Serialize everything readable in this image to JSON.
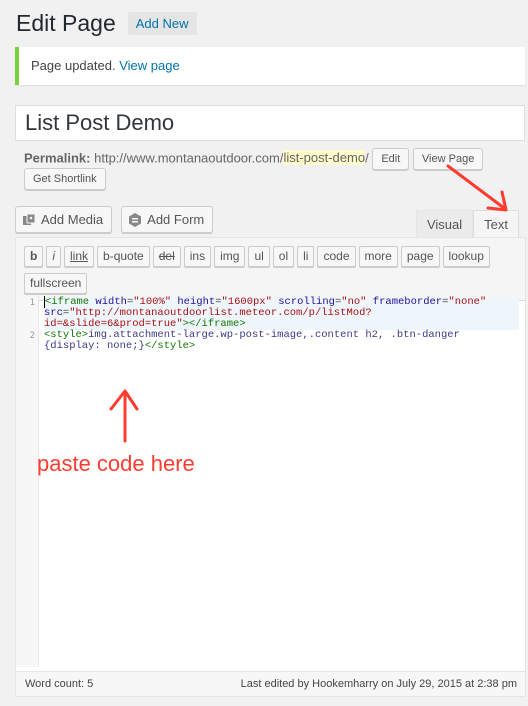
{
  "header": {
    "title": "Edit Page",
    "add_new_label": "Add New"
  },
  "notice": {
    "message": "Page updated.",
    "link_label": "View page"
  },
  "post": {
    "title": "List Post Demo",
    "permalink_label": "Permalink:",
    "permalink_base": "http://www.montanaoutdoor.com/",
    "permalink_slug": "list-post-demo",
    "permalink_trailing": "/",
    "edit_label": "Edit",
    "view_label": "View Page",
    "shortlink_label": "Get Shortlink"
  },
  "media_buttons": {
    "add_media": "Add Media",
    "add_form": "Add Form"
  },
  "editor_tabs": {
    "visual": "Visual",
    "text": "Text"
  },
  "quicktags": [
    "b",
    "i",
    "link",
    "b-quote",
    "del",
    "ins",
    "img",
    "ul",
    "ol",
    "li",
    "code",
    "more",
    "page",
    "lookup",
    "fullscreen"
  ],
  "code": {
    "line_numbers": [
      "1",
      "2"
    ],
    "line1_part1": "<iframe",
    "line1_a1": "width",
    "line1_v1": "\"100%\"",
    "line1_a2": "height",
    "line1_v2": "\"1600px\"",
    "line1_a3": "scrolling",
    "line1_v3": "\"no\"",
    "line1_a4": "frameborder",
    "line1_v4": "\"none\"",
    "line1_a5": "src",
    "line1_v5a": "\"http://montanaoutdoorlist.meteor.com/p/listMod?",
    "line1_v5b": "id=&slide=6&prod=true\"",
    "line1_close": "></iframe>",
    "line2_open": "<style>",
    "line2_css": "img.attachment-large.wp-post-image,.content h2, .btn-danger {display: none;}",
    "line2_close": "</style>"
  },
  "status": {
    "word_count": "Word count: 5",
    "last_edited": "Last edited by Hookemharry on July 29, 2015 at 2:38 pm"
  },
  "annotation": {
    "text": "paste code here",
    "color": "#ff3b30"
  },
  "colors": {
    "link": "#0073aa",
    "notice_border": "#7ad03a",
    "annotation": "#ff3b30"
  }
}
